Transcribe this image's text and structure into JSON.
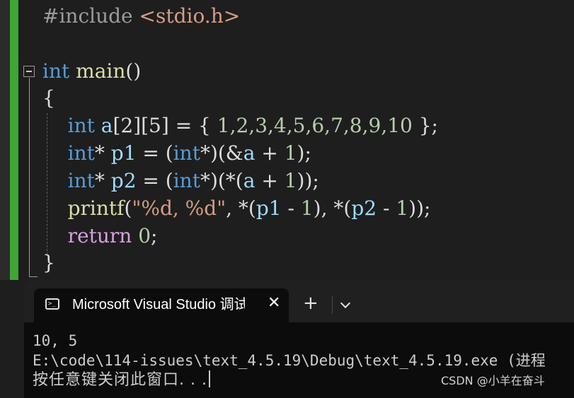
{
  "editor": {
    "lines": [
      [
        {
          "t": "#include ",
          "c": "#9b9b9b"
        },
        {
          "t": "<stdio.h>",
          "c": "#d69d85"
        }
      ],
      [],
      [
        {
          "t": "int",
          "c": "#569cd6"
        },
        {
          "t": " ",
          "c": "#dcdcdc"
        },
        {
          "t": "main",
          "c": "#dcdcaa"
        },
        {
          "t": "()",
          "c": "#dcdcdc"
        }
      ],
      [
        {
          "t": "{",
          "c": "#dcdcdc"
        }
      ],
      [
        {
          "t": "    ",
          "c": "#dcdcdc"
        },
        {
          "t": "int",
          "c": "#569cd6"
        },
        {
          "t": " ",
          "c": "#dcdcdc"
        },
        {
          "t": "a",
          "c": "#9cdcfe"
        },
        {
          "t": "[2][5] = { ",
          "c": "#dcdcdc"
        },
        {
          "t": "1,2,3,4,5,6,7,8,9,10",
          "c": "#b5cea8"
        },
        {
          "t": " };",
          "c": "#dcdcdc"
        }
      ],
      [
        {
          "t": "    ",
          "c": "#dcdcdc"
        },
        {
          "t": "int",
          "c": "#569cd6"
        },
        {
          "t": "* ",
          "c": "#dcdcdc"
        },
        {
          "t": "p1",
          "c": "#9cdcfe"
        },
        {
          "t": " = (",
          "c": "#dcdcdc"
        },
        {
          "t": "int",
          "c": "#569cd6"
        },
        {
          "t": "*)(&",
          "c": "#dcdcdc"
        },
        {
          "t": "a",
          "c": "#9cdcfe"
        },
        {
          "t": " + ",
          "c": "#dcdcdc"
        },
        {
          "t": "1",
          "c": "#b5cea8"
        },
        {
          "t": ");",
          "c": "#dcdcdc"
        }
      ],
      [
        {
          "t": "    ",
          "c": "#dcdcdc"
        },
        {
          "t": "int",
          "c": "#569cd6"
        },
        {
          "t": "* ",
          "c": "#dcdcdc"
        },
        {
          "t": "p2",
          "c": "#9cdcfe"
        },
        {
          "t": " = (",
          "c": "#dcdcdc"
        },
        {
          "t": "int",
          "c": "#569cd6"
        },
        {
          "t": "*)(*(",
          "c": "#dcdcdc"
        },
        {
          "t": "a",
          "c": "#9cdcfe"
        },
        {
          "t": " + ",
          "c": "#dcdcdc"
        },
        {
          "t": "1",
          "c": "#b5cea8"
        },
        {
          "t": "));",
          "c": "#dcdcdc"
        }
      ],
      [
        {
          "t": "    ",
          "c": "#dcdcdc"
        },
        {
          "t": "printf",
          "c": "#dcdcaa"
        },
        {
          "t": "(",
          "c": "#dcdcdc"
        },
        {
          "t": "\"%d, %d\"",
          "c": "#d69d85"
        },
        {
          "t": ", *(",
          "c": "#dcdcdc"
        },
        {
          "t": "p1",
          "c": "#9cdcfe"
        },
        {
          "t": " - ",
          "c": "#dcdcdc"
        },
        {
          "t": "1",
          "c": "#b5cea8"
        },
        {
          "t": "), *(",
          "c": "#dcdcdc"
        },
        {
          "t": "p2",
          "c": "#9cdcfe"
        },
        {
          "t": " - ",
          "c": "#dcdcdc"
        },
        {
          "t": "1",
          "c": "#b5cea8"
        },
        {
          "t": "));",
          "c": "#dcdcdc"
        }
      ],
      [
        {
          "t": "    ",
          "c": "#dcdcdc"
        },
        {
          "t": "return",
          "c": "#d8a0df"
        },
        {
          "t": " ",
          "c": "#dcdcdc"
        },
        {
          "t": "0",
          "c": "#b5cea8"
        },
        {
          "t": ";",
          "c": "#dcdcdc"
        }
      ],
      [
        {
          "t": "}",
          "c": "#dcdcdc"
        }
      ]
    ]
  },
  "terminal": {
    "tab_title": "Microsoft Visual Studio 调试控制台",
    "tab_icon_glyph": ">_",
    "close_glyph": "✕",
    "new_tab_glyph": "+",
    "output": [
      "10, 5",
      "E:\\code\\114-issues\\text_4.5.19\\Debug\\text_4.5.19.exe (进程",
      "按任意键关闭此窗口. . ."
    ]
  },
  "watermark": "CSDN @小羊在奋斗",
  "colors": {
    "editor_bg": "#1e1e1e",
    "change_bar": "#3fa535",
    "terminal_bg": "#0c0c0c",
    "tabbar_bg": "#202020"
  },
  "icons": [
    "terminal-tab-icon",
    "close-icon",
    "plus-icon",
    "chevron-down-icon",
    "collapse-icon"
  ]
}
